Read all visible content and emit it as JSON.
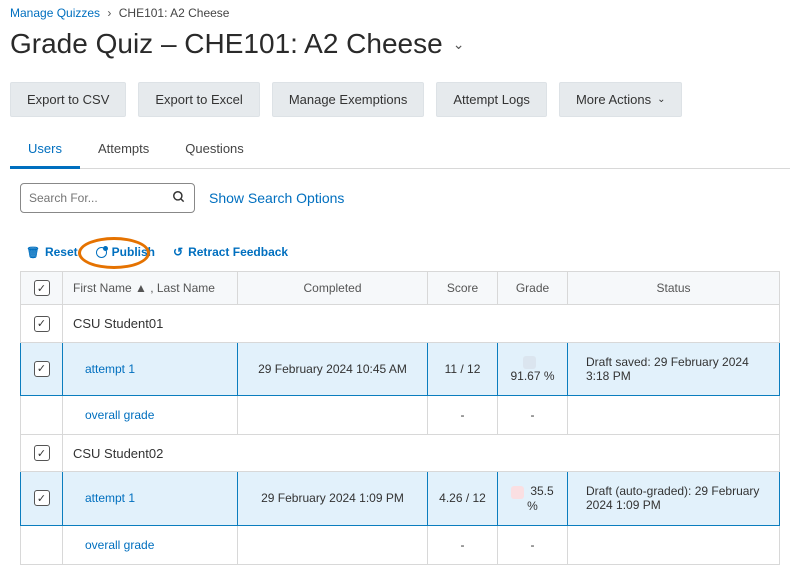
{
  "breadcrumb": {
    "root": "Manage Quizzes",
    "current": "CHE101: A2 Cheese"
  },
  "page_title": "Grade Quiz – CHE101: A2 Cheese",
  "toolbar": {
    "export_csv": "Export to CSV",
    "export_excel": "Export to Excel",
    "manage_exemptions": "Manage Exemptions",
    "attempt_logs": "Attempt Logs",
    "more_actions": "More Actions"
  },
  "tabs": {
    "users": "Users",
    "attempts": "Attempts",
    "questions": "Questions"
  },
  "search": {
    "placeholder": "Search For...",
    "show_options": "Show Search Options"
  },
  "actions": {
    "reset": "Reset",
    "publish": "Publish",
    "retract": "Retract Feedback"
  },
  "table": {
    "headers": {
      "name": "First Name ▲ , Last Name",
      "completed": "Completed",
      "score": "Score",
      "grade": "Grade",
      "status": "Status"
    },
    "students": [
      {
        "name": "CSU Student01",
        "attempt": {
          "label": "attempt 1",
          "completed": "29 February 2024 10:45 AM",
          "score": "11 / 12",
          "grade": "91.67 %",
          "grade_color": "blue",
          "status": "Draft saved: 29 February 2024 3:18 PM"
        },
        "overall": {
          "label": "overall grade",
          "completed_dash": "-",
          "score_dash": "-"
        }
      },
      {
        "name": "CSU Student02",
        "attempt": {
          "label": "attempt 1",
          "completed": "29 February 2024 1:09 PM",
          "score": "4.26 / 12",
          "grade": "35.5 %",
          "grade_color": "pink",
          "status": "Draft (auto-graded): 29 February 2024 1:09 PM"
        },
        "overall": {
          "label": "overall grade",
          "completed_dash": "-",
          "score_dash": "-"
        }
      }
    ]
  }
}
